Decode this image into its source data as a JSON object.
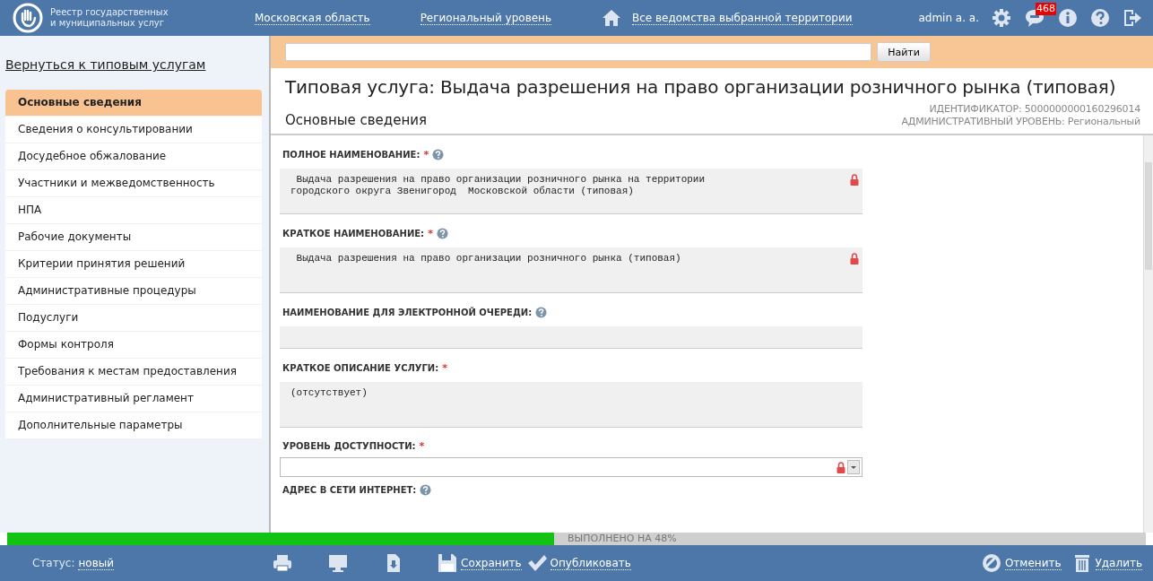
{
  "header": {
    "logo_text": "Реестр государственных и муниципальных услуг",
    "links": [
      "Московская область",
      "Региональный уровень",
      "Все ведомства выбранной территории"
    ],
    "user": "admin a. a.",
    "notifications": "468"
  },
  "sidebar": {
    "back_link": "Вернуться к типовым услугам",
    "items": [
      {
        "label": "Основные сведения",
        "selected": true
      },
      {
        "label": "Сведения о консультировании",
        "selected": false
      },
      {
        "label": "Досудебное обжалование",
        "selected": false
      },
      {
        "label": "Участники и межведомственность",
        "selected": false
      },
      {
        "label": "НПА",
        "selected": false
      },
      {
        "label": "Рабочие документы",
        "selected": false
      },
      {
        "label": "Критерии принятия решений",
        "selected": false
      },
      {
        "label": "Административные процедуры",
        "selected": false
      },
      {
        "label": "Подуслуги",
        "selected": false
      },
      {
        "label": "Формы контроля",
        "selected": false
      },
      {
        "label": "Требования к местам предоставления",
        "selected": false
      },
      {
        "label": "Административный регламент",
        "selected": false
      },
      {
        "label": "Дополнительные параметры",
        "selected": false
      }
    ]
  },
  "search": {
    "button": "Найти"
  },
  "title": "Типовая услуга:  Выдача разрешения на право организации розничного рынка (типовая)",
  "section_title": "Основные сведения",
  "required_mark": "*",
  "identifier": "ИДЕНТИФИКАТОР: 5000000000160296014",
  "admin_level": "АДМИНИСТРАТИВНЫЙ УРОВЕНЬ: Региональный",
  "fields": [
    {
      "kind": "text",
      "label": "ПОЛНОЕ НАИМЕНОВАНИЕ:",
      "required": true,
      "help": true,
      "locked": true,
      "value": " Выдача разрешения на право организации розничного рынка на территории\nгородского округа Звенигород  Московской области (типовая)"
    },
    {
      "kind": "text",
      "label": "КРАТКОЕ НАИМЕНОВАНИЕ:",
      "required": true,
      "help": true,
      "locked": true,
      "value": " Выдача разрешения на право организации розничного рынка (типовая)"
    },
    {
      "kind": "line",
      "label": "НАИМЕНОВАНИЕ ДЛЯ ЭЛЕКТРОННОЙ ОЧЕРЕДИ:",
      "required": false,
      "help": true,
      "locked": false
    },
    {
      "kind": "text",
      "label": "КРАТКОЕ ОПИСАНИЕ УСЛУГИ:",
      "required": true,
      "help": false,
      "locked": false,
      "value": "(отсутствует)"
    },
    {
      "kind": "select",
      "label": "УРОВЕНЬ ДОСТУПНОСТИ:",
      "required": true,
      "help": false,
      "locked": true
    },
    {
      "kind": "label",
      "label": "АДРЕС В СЕТИ ИНТЕРНЕТ:",
      "required": false,
      "help": true,
      "locked": false
    }
  ],
  "progress": {
    "level": 0.48,
    "text": "ВЫПОЛНЕНО НА 48%"
  },
  "footer": {
    "status_label": "Статус:",
    "status_value": "новый",
    "save": "Сохранить",
    "publish": "Опубликовать",
    "cancel": "Отменить",
    "delete": "Удалить"
  }
}
